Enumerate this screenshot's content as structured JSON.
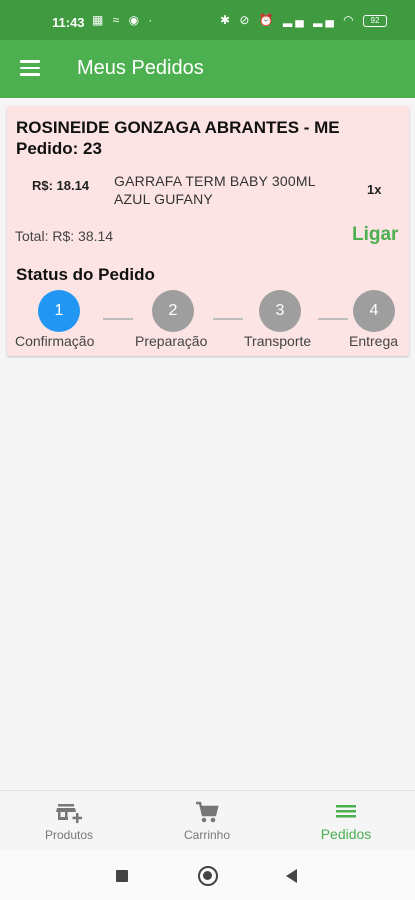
{
  "status_bar": {
    "time": "11:43",
    "battery": "92"
  },
  "app_bar": {
    "title": "Meus Pedidos"
  },
  "order": {
    "store": "ROSINEIDE GONZAGA ABRANTES - ME",
    "number": "Pedido: 23",
    "items": [
      {
        "price": "R$: 18.14",
        "name": "GARRAFA TERM BABY 300ML AZUL GUFANY",
        "qty": "1x"
      }
    ],
    "total": "Total: R$: 38.14",
    "call_label": "Ligar",
    "status_title": "Status do Pedido",
    "steps": [
      {
        "num": "1",
        "label": "Confirmação",
        "active": true
      },
      {
        "num": "2",
        "label": "Preparação",
        "active": false
      },
      {
        "num": "3",
        "label": "Transporte",
        "active": false
      },
      {
        "num": "4",
        "label": "Entrega",
        "active": false
      }
    ]
  },
  "bottom_nav": [
    {
      "label": "Produtos",
      "icon": "store-add-icon",
      "active": false
    },
    {
      "label": "Carrinho",
      "icon": "cart-icon",
      "active": false
    },
    {
      "label": "Pedidos",
      "icon": "list-icon",
      "active": true
    }
  ],
  "colors": {
    "primary": "#4caf50",
    "status_bar": "#3f9a40",
    "card_bg": "#fde4e4",
    "step_active": "#2196f3",
    "step_inactive": "#9e9e9e"
  }
}
